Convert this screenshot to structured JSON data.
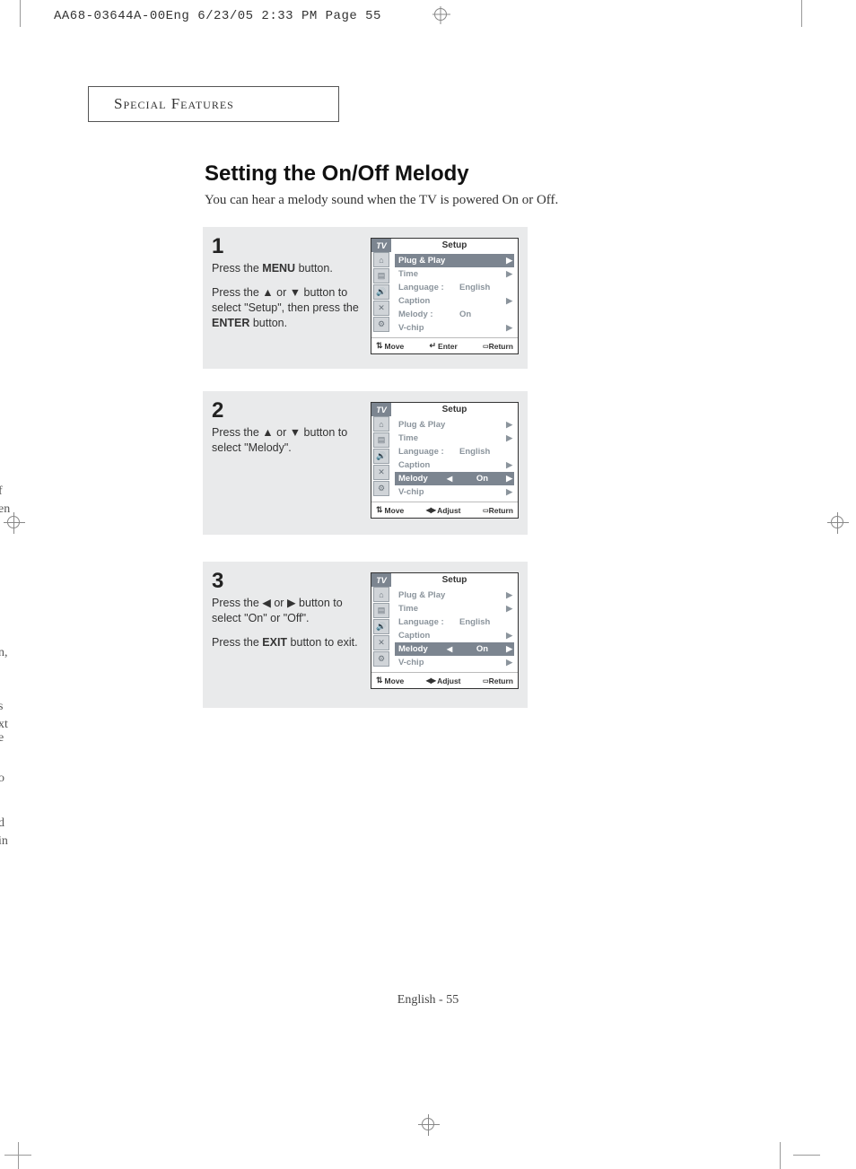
{
  "print_header": "AA68-03644A-00Eng  6/23/05  2:33 PM  Page 55",
  "section_label": "Special Features",
  "heading": "Setting the On/Off Melody",
  "intro": "You can hear a melody sound when the TV is powered On or Off.",
  "footer": "English - 55",
  "edge_fragments": [
    "f",
    "en",
    "n,",
    "s",
    "xt",
    "e",
    "o",
    "d",
    "in"
  ],
  "steps": [
    {
      "num": "1",
      "paras": [
        "Press the <b>MENU</b> button.",
        "Press the ▲ or ▼ button to select \"Setup\", then press the <b>ENTER</b> button."
      ],
      "osd": {
        "tv": "TV",
        "title": "Setup",
        "rows": [
          {
            "label": "Plug & Play",
            "value": "",
            "hl": true,
            "adjust": false,
            "chev": true
          },
          {
            "label": "Time",
            "value": "",
            "hl": false,
            "adjust": false,
            "chev": true
          },
          {
            "label": "Language :",
            "value": "English",
            "hl": false,
            "adjust": false,
            "chev": false
          },
          {
            "label": "Caption",
            "value": "",
            "hl": false,
            "adjust": false,
            "chev": true
          },
          {
            "label": "Melody   :",
            "value": "On",
            "hl": false,
            "adjust": false,
            "chev": false
          },
          {
            "label": "V-chip",
            "value": "",
            "hl": false,
            "adjust": false,
            "chev": true
          }
        ],
        "foot": [
          "Move",
          "Enter",
          "Return"
        ],
        "foot_mode": "enter"
      }
    },
    {
      "num": "2",
      "paras": [
        "Press the ▲ or ▼ button to select \"Melody\"."
      ],
      "osd": {
        "tv": "TV",
        "title": "Setup",
        "rows": [
          {
            "label": "Plug & Play",
            "value": "",
            "hl": false,
            "adjust": false,
            "chev": true
          },
          {
            "label": "Time",
            "value": "",
            "hl": false,
            "adjust": false,
            "chev": true
          },
          {
            "label": "Language :",
            "value": "English",
            "hl": false,
            "adjust": false,
            "chev": false
          },
          {
            "label": "Caption",
            "value": "",
            "hl": false,
            "adjust": false,
            "chev": true
          },
          {
            "label": "Melody",
            "value": "On",
            "hl": true,
            "adjust": true,
            "chev": true
          },
          {
            "label": "V-chip",
            "value": "",
            "hl": false,
            "adjust": false,
            "chev": true
          }
        ],
        "foot": [
          "Move",
          "Adjust",
          "Return"
        ],
        "foot_mode": "adjust"
      }
    },
    {
      "num": "3",
      "paras": [
        "Press the ◀ or ▶ button to select \"On\" or \"Off\".",
        "Press the <b>EXIT</b> button to exit."
      ],
      "osd": {
        "tv": "TV",
        "title": "Setup",
        "rows": [
          {
            "label": "Plug & Play",
            "value": "",
            "hl": false,
            "adjust": false,
            "chev": true
          },
          {
            "label": "Time",
            "value": "",
            "hl": false,
            "adjust": false,
            "chev": true
          },
          {
            "label": "Language :",
            "value": "English",
            "hl": false,
            "adjust": false,
            "chev": false
          },
          {
            "label": "Caption",
            "value": "",
            "hl": false,
            "adjust": false,
            "chev": true
          },
          {
            "label": "Melody",
            "value": "On",
            "hl": true,
            "adjust": true,
            "chev": true
          },
          {
            "label": "V-chip",
            "value": "",
            "hl": false,
            "adjust": false,
            "chev": true
          }
        ],
        "foot": [
          "Move",
          "Adjust",
          "Return"
        ],
        "foot_mode": "adjust"
      }
    }
  ],
  "osd_icons_glyphs": [
    "⌂",
    "▤",
    "🔊",
    "✕",
    "⚙"
  ]
}
